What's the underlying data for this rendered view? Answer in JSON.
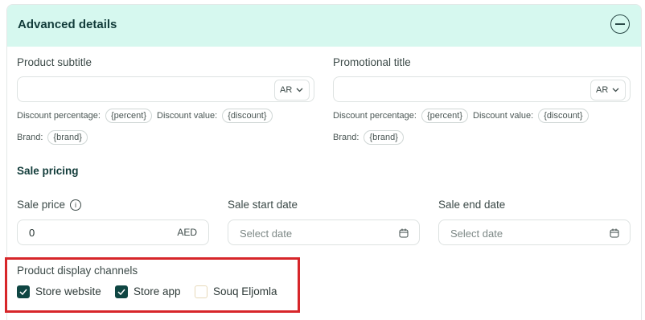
{
  "header": {
    "title": "Advanced details"
  },
  "product_subtitle": {
    "label": "Product subtitle",
    "value": "",
    "lang": "AR"
  },
  "promotional_title": {
    "label": "Promotional title",
    "value": "",
    "lang": "AR"
  },
  "tokens": {
    "discount_percentage_label": "Discount percentage:",
    "percent_chip": "{percent}",
    "discount_value_label": "Discount value:",
    "discount_chip": "{discount}",
    "brand_label": "Brand:",
    "brand_chip": "{brand}"
  },
  "sale_pricing": {
    "title": "Sale pricing",
    "sale_price_label": "Sale price",
    "sale_price_value": "0",
    "currency": "AED",
    "start_label": "Sale start date",
    "start_placeholder": "Select date",
    "end_label": "Sale end date",
    "end_placeholder": "Select date"
  },
  "display_channels": {
    "title": "Product display channels",
    "options": [
      {
        "label": "Store website",
        "checked": true
      },
      {
        "label": "Store app",
        "checked": true
      },
      {
        "label": "Souq Eljomla",
        "checked": false
      }
    ]
  },
  "colors": {
    "header_bg": "#d6f8ef",
    "accent": "#0f4643",
    "highlight": "#d7262a"
  }
}
